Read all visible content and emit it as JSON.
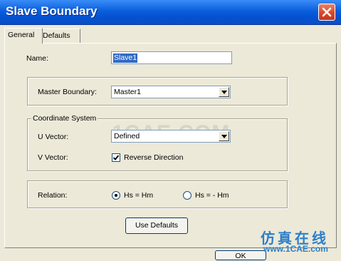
{
  "window": {
    "title": "Slave Boundary"
  },
  "tabs": [
    {
      "label": "General",
      "active": true
    },
    {
      "label": "Defaults",
      "active": false
    }
  ],
  "general": {
    "name_label": "Name:",
    "name_value": "Slave1",
    "master_boundary_label": "Master Boundary:",
    "master_boundary_value": "Master1",
    "coordinate_system_label": "Coordinate System",
    "u_vector_label": "U  Vector:",
    "u_vector_value": "Defined",
    "v_vector_label": "V  Vector:",
    "reverse_direction_label": "Reverse Direction",
    "reverse_direction_checked": true,
    "relation_label": "Relation:",
    "relation_options": [
      {
        "label": "Hs = Hm",
        "selected": true
      },
      {
        "label": "Hs = - Hm",
        "selected": false
      }
    ],
    "use_defaults_label": "Use Defaults"
  },
  "footer": {
    "ok_label": "OK"
  },
  "watermark": {
    "text": "1CAE.COM",
    "brand": "仿真在线",
    "brand_url": "www.1CAE.com"
  },
  "colors": {
    "titlebar": "#0a5fdc",
    "dialog_bg": "#ece9d8",
    "selection": "#316ac5",
    "close": "#d9462b"
  }
}
